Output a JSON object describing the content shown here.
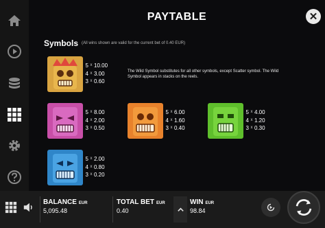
{
  "header": {
    "title": "PAYTABLE",
    "close_label": "✕"
  },
  "sidebar": {
    "items": [
      {
        "name": "home"
      },
      {
        "name": "autoplay"
      },
      {
        "name": "bet"
      },
      {
        "name": "paytable",
        "active": true
      },
      {
        "name": "settings"
      },
      {
        "name": "help"
      }
    ]
  },
  "symbols_section": {
    "title": "Symbols",
    "subtitle": "(All wins shown are valid for the current bet of 0.40 EUR)",
    "times_sign": "x",
    "wild_description": "The Wild Symbol substitutes for all other symbols, except Scatter symbol. The Wild Symbol appears in stacks on the reels.",
    "symbols": [
      {
        "name": "wild-tiki",
        "color": "#d9a441",
        "pays": [
          {
            "count": "5",
            "value": "10.00"
          },
          {
            "count": "4",
            "value": "3.00"
          },
          {
            "count": "3",
            "value": "0.60"
          }
        ]
      },
      {
        "name": "pink-tiki",
        "color": "#c84fa8",
        "pays": [
          {
            "count": "5",
            "value": "8.00"
          },
          {
            "count": "4",
            "value": "2.00"
          },
          {
            "count": "3",
            "value": "0.50"
          }
        ]
      },
      {
        "name": "orange-tiki",
        "color": "#e8822c",
        "pays": [
          {
            "count": "5",
            "value": "6.00"
          },
          {
            "count": "4",
            "value": "1.60"
          },
          {
            "count": "3",
            "value": "0.40"
          }
        ]
      },
      {
        "name": "green-tiki",
        "color": "#5fbf2c",
        "pays": [
          {
            "count": "5",
            "value": "4.00"
          },
          {
            "count": "4",
            "value": "1.20"
          },
          {
            "count": "3",
            "value": "0.30"
          }
        ]
      },
      {
        "name": "blue-tiki",
        "color": "#2f86c9",
        "pays": [
          {
            "count": "5",
            "value": "2.00"
          },
          {
            "count": "4",
            "value": "0.80"
          },
          {
            "count": "3",
            "value": "0.20"
          }
        ]
      }
    ]
  },
  "bottom_bar": {
    "balance": {
      "label": "BALANCE",
      "currency": "EUR",
      "value": "5,095.48"
    },
    "total_bet": {
      "label": "TOTAL BET",
      "currency": "EUR",
      "value": "0.40"
    },
    "win": {
      "label": "WIN",
      "currency": "EUR",
      "value": "98.84"
    }
  },
  "colors": {
    "accent": "#ffffff",
    "background": "#0b0b0d",
    "bar": "#1b1b1b"
  }
}
